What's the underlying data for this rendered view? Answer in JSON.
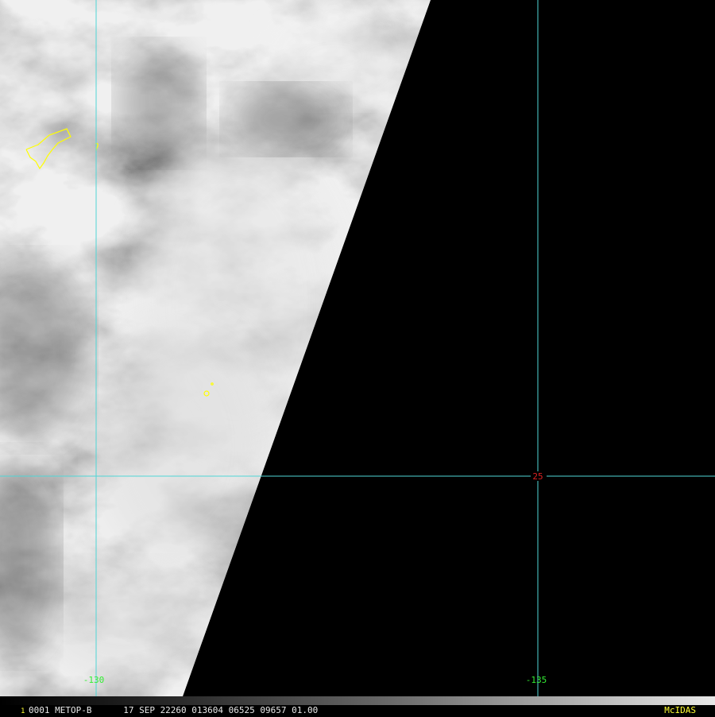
{
  "grid": {
    "line_color": "#4fd6d6",
    "lon_labels": [
      "-130",
      "-135"
    ],
    "lon_label_color": "#33ee33",
    "lat_labels": [
      "25"
    ],
    "lat_label_color": "#dd2222"
  },
  "overlay": {
    "coastline_color": "#ffff00"
  },
  "status": {
    "frame": "1",
    "line": "0001 METOP-B      17 SEP 22260 013604 06525 09657 01.00",
    "brand": "McIDAS"
  }
}
